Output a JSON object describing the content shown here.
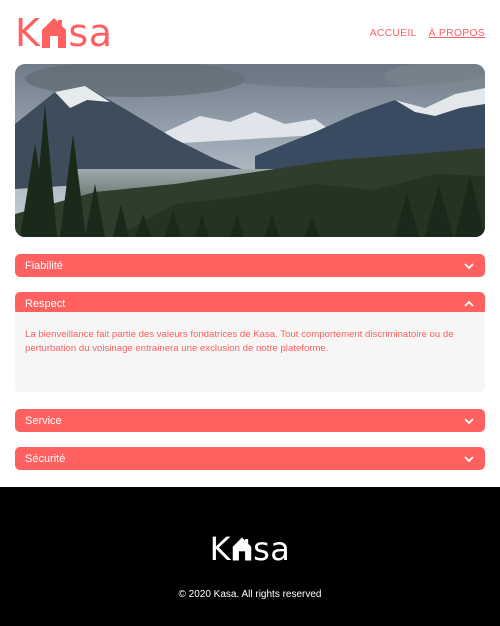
{
  "header": {
    "logo_left": "K",
    "logo_right": "sa",
    "nav": [
      "ACCUEIL",
      "À PROPOS"
    ]
  },
  "accordion": [
    {
      "title": "Fiabilité",
      "open": false
    },
    {
      "title": "Respect",
      "open": true,
      "content": "La bienveillance fait partie des valeurs fondatrices de Kasa. Tout comportement discriminatoire ou de perturbation du voisinage entrainera une exclusion de notre plateforme."
    },
    {
      "title": "Service",
      "open": false
    },
    {
      "title": "Sécurité",
      "open": false
    }
  ],
  "footer": {
    "logo_left": "K",
    "logo_right": "sa",
    "copyright": "© 2020 Kasa. All rights reserved"
  },
  "colors": {
    "accent": "#ff6060",
    "footer_bg": "#000000",
    "panel_bg": "#f6f6f6"
  }
}
